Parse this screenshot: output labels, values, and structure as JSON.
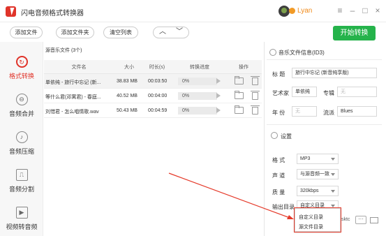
{
  "app": {
    "title": "闪电音频格式转换器",
    "user": "Lyan"
  },
  "window": {
    "menu": "≡",
    "minimize": "–",
    "maximize": "□",
    "close": "×"
  },
  "toolbar": {
    "add_file": "添加文件",
    "add_folder": "添加文件夹",
    "clear_list": "清空列表",
    "move_up": "︿",
    "move_down": "﹀",
    "start": "开始转换"
  },
  "sidebar": {
    "items": [
      {
        "label": "格式转换",
        "icon": "↻",
        "active": true
      },
      {
        "label": "音频合并",
        "icon": "⊖"
      },
      {
        "label": "音频压缩",
        "icon": "♪"
      },
      {
        "label": "音频分割",
        "icon": "⎍"
      },
      {
        "label": "视频转音频",
        "icon": "▶"
      }
    ]
  },
  "file_list": {
    "header": "源音乐文件 (3个)",
    "columns": {
      "name": "文件名",
      "size": "大小",
      "duration": "时长(s)",
      "progress": "转换进度",
      "actions": "操作"
    },
    "rows": [
      {
        "name": "单依纯 - 旅行中忘记 (新...",
        "size": "38.83 MB",
        "duration": "00:03:50",
        "progress": "0%"
      },
      {
        "name": "等什么君(邓寓君) - 春庭...",
        "size": "40.52 MB",
        "duration": "00:04:00",
        "progress": "0%"
      },
      {
        "name": "刘惜君 - 怎么唱情歌.wav",
        "size": "50.43 MB",
        "duration": "00:04:59",
        "progress": "0%"
      }
    ]
  },
  "id3": {
    "title": "音乐文件信息(ID3)",
    "label_title": "标  题",
    "value_title": "旅行中忘记 (新音纯享版)",
    "label_artist": "艺术家",
    "value_artist": "单依纯",
    "label_album": "专辑",
    "value_album": "无",
    "label_year": "年  份",
    "value_year": "无",
    "label_genre": "流派",
    "value_genre": "Blues"
  },
  "settings": {
    "title": "设置",
    "label_format": "格    式",
    "value_format": "MP3",
    "label_channel": "声    道",
    "value_channel": "与源音频一致",
    "label_quality": "质    量",
    "value_quality": "320kbps",
    "label_output": "输出目录",
    "value_output": "自定义目录",
    "output_tail": "sktc",
    "dots": "···",
    "dropdown_options": [
      "自定义目录",
      "源文件目录"
    ]
  },
  "colors": {
    "accent": "#e0342a",
    "start_button": "#25b34b",
    "user_name": "#f08a1a"
  }
}
